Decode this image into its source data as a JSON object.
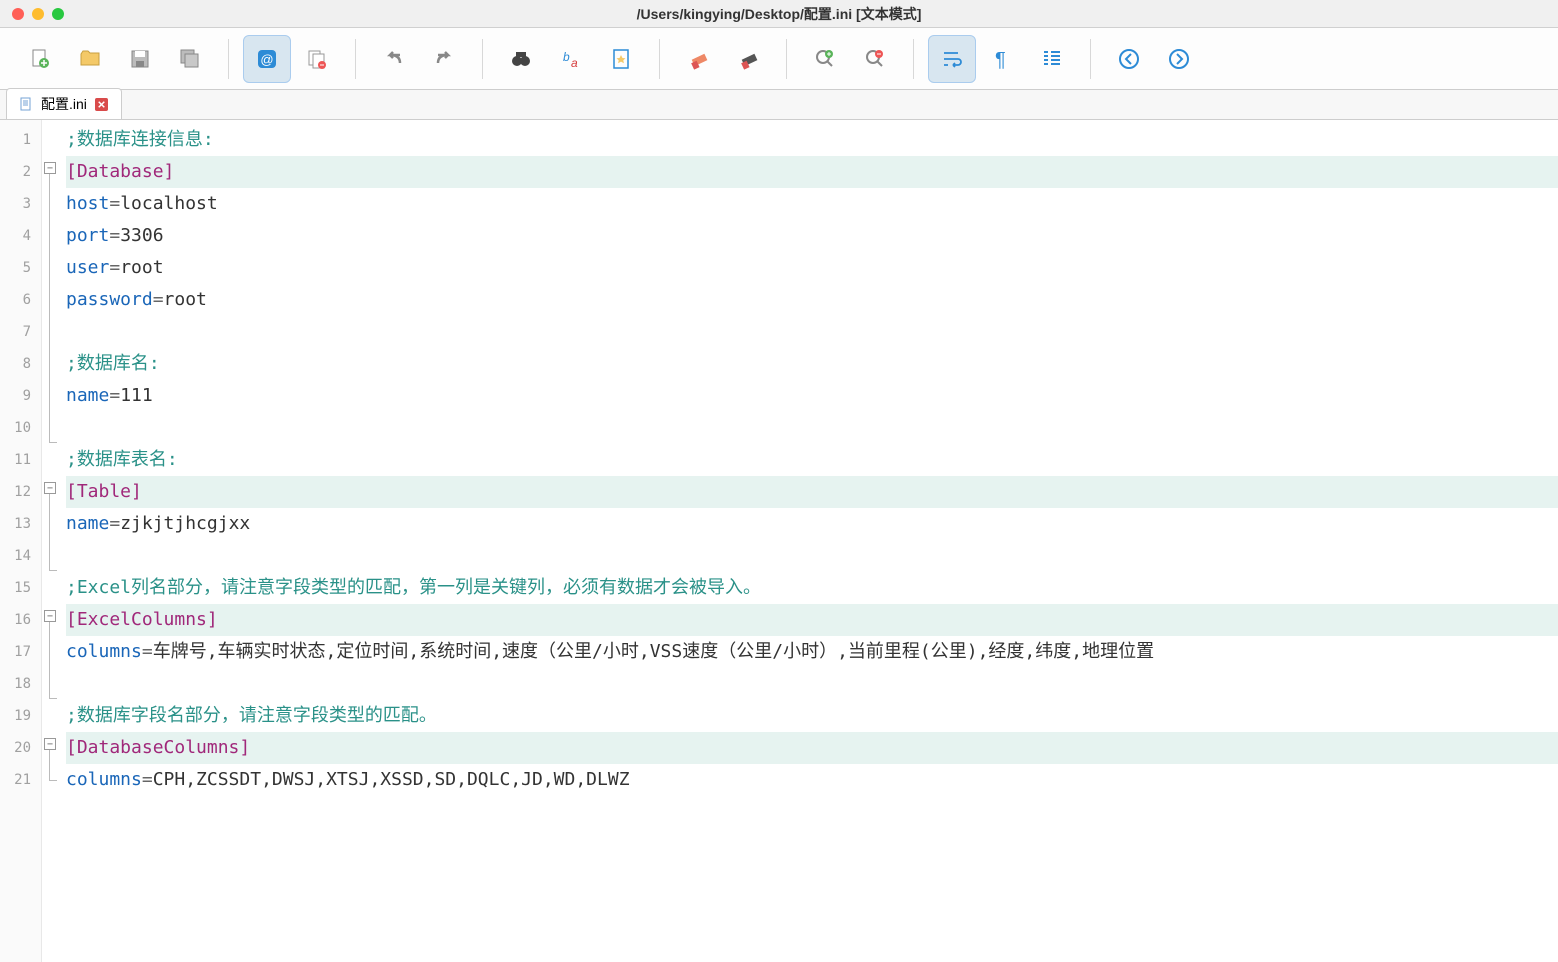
{
  "window": {
    "title": "/Users/kingying/Desktop/配置.ini [文本模式]"
  },
  "tab": {
    "label": "配置.ini"
  },
  "toolbar_icons": {
    "new": "new-file",
    "open": "open-file",
    "save": "save",
    "saveall": "save-all",
    "lang": "language",
    "copy": "copy",
    "undo": "undo",
    "redo": "redo",
    "find": "find",
    "replace": "replace",
    "bookmark": "bookmark",
    "erase1": "eraser",
    "erase2": "eraser-alt",
    "zoomin": "zoom-in",
    "zoomout": "zoom-out",
    "wrap": "word-wrap",
    "pilcrow": "show-paragraph",
    "indent": "indent-guide",
    "prev": "prev",
    "next": "next"
  },
  "code": {
    "l1": {
      "comment": ";数据库连接信息:"
    },
    "l2": {
      "section": "[Database]"
    },
    "l3": {
      "key": "host",
      "val": "localhost"
    },
    "l4": {
      "key": "port",
      "val": "3306"
    },
    "l5": {
      "key": "user",
      "val": "root"
    },
    "l6": {
      "key": "password",
      "val": "root"
    },
    "l8": {
      "comment": ";数据库名:"
    },
    "l9": {
      "key": "name",
      "val": "111"
    },
    "l11": {
      "comment": ";数据库表名:"
    },
    "l12": {
      "section": "[Table]"
    },
    "l13": {
      "key": "name",
      "val": "zjkjtjhcgjxx"
    },
    "l15": {
      "comment": ";Excel列名部分，请注意字段类型的匹配，第一列是关键列，必须有数据才会被导入。"
    },
    "l16": {
      "section": "[ExcelColumns]"
    },
    "l17": {
      "key": "columns",
      "val": "车牌号,车辆实时状态,定位时间,系统时间,速度（公里/小时,VSS速度（公里/小时）,当前里程(公里),经度,纬度,地理位置"
    },
    "l19": {
      "comment": ";数据库字段名部分，请注意字段类型的匹配。"
    },
    "l20": {
      "section": "[DatabaseColumns]"
    },
    "l21": {
      "key": "columns",
      "val": "CPH,ZCSSDT,DWSJ,XTSJ,XSSD,SD,DQLC,JD,WD,DLWZ"
    }
  },
  "line_numbers": [
    "1",
    "2",
    "3",
    "4",
    "5",
    "6",
    "7",
    "8",
    "9",
    "10",
    "11",
    "12",
    "13",
    "14",
    "15",
    "16",
    "17",
    "18",
    "19",
    "20",
    "21"
  ]
}
